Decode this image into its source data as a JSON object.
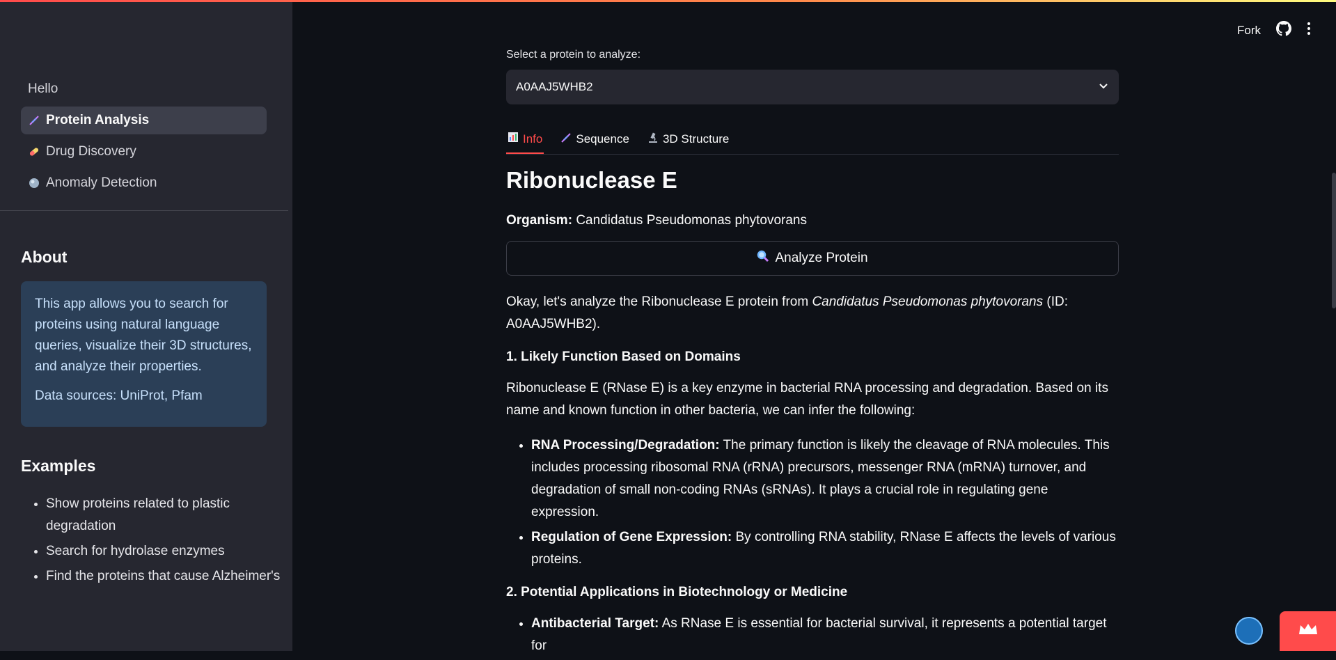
{
  "sidebar": {
    "nav": [
      {
        "label": "Hello",
        "icon": ""
      },
      {
        "label": "Protein Analysis",
        "icon": "dna-icon"
      },
      {
        "label": "Drug Discovery",
        "icon": "pill-icon"
      },
      {
        "label": "Anomaly Detection",
        "icon": "circle-icon"
      }
    ],
    "about_heading": "About",
    "about_text": "This app allows you to search for proteins using natural language queries, visualize their 3D structures, and analyze their properties.",
    "about_sources": "Data sources: UniProt, Pfam",
    "examples_heading": "Examples",
    "examples": [
      "Show proteins related to plastic degradation",
      "Search for hydrolase enzymes",
      "Find the proteins that cause Alzheimer's"
    ]
  },
  "header": {
    "fork_label": "Fork"
  },
  "main": {
    "select_label": "Select a protein to analyze:",
    "selected_protein": "A0AAJ5WHB2",
    "tabs": [
      {
        "label": "Info",
        "icon": "chart-icon"
      },
      {
        "label": "Sequence",
        "icon": "dna-icon"
      },
      {
        "label": "3D Structure",
        "icon": "microscope-icon"
      }
    ],
    "title": "Ribonuclease E",
    "organism_label": "Organism:",
    "organism_value": "Candidatus Pseudomonas phytovorans",
    "analyze_button": "Analyze Protein",
    "intro_pre": "Okay, let's analyze the Ribonuclease E protein from ",
    "intro_italic": "Candidatus Pseudomonas phytovorans",
    "intro_post": " (ID: A0AAJ5WHB2).",
    "section1": "1. Likely Function Based on Domains",
    "section1_para": "Ribonuclease E (RNase E) is a key enzyme in bacterial RNA processing and degradation. Based on its name and known function in other bacteria, we can infer the following:",
    "bullets1": [
      {
        "bold": "RNA Processing/Degradation:",
        "text": " The primary function is likely the cleavage of RNA molecules. This includes processing ribosomal RNA (rRNA) precursors, messenger RNA (mRNA) turnover, and degradation of small non-coding RNAs (sRNAs). It plays a crucial role in regulating gene expression."
      },
      {
        "bold": "Regulation of Gene Expression:",
        "text": " By controlling RNA stability, RNase E affects the levels of various proteins."
      }
    ],
    "section2": "2. Potential Applications in Biotechnology or Medicine",
    "bullets2": [
      {
        "bold": "Antibacterial Target:",
        "text": " As RNase E is essential for bacterial survival, it represents a potential target for"
      }
    ]
  },
  "colors": {
    "accent": "#ff4b4b",
    "background": "#0e1117",
    "sidebar": "#262730",
    "info_box": "#2b3f57"
  }
}
